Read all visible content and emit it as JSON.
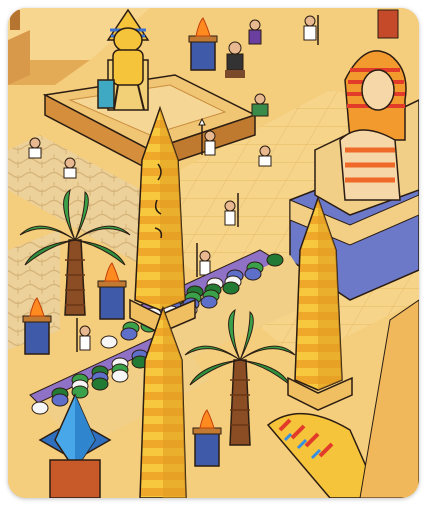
{
  "scene": {
    "title": "",
    "colors": {
      "sand_light": "#f8d98c",
      "sand_mid": "#efc06b",
      "sand_dark": "#d99c45",
      "plaza_tile": "#f3cf86",
      "cobble": "#e9c78e",
      "obelisk_gold": "#f4c23a",
      "obelisk_shade": "#e09a1f",
      "palm_green": "#3aa14a",
      "palm_dark": "#237a35",
      "trunk": "#8a4d24",
      "stone_blue": "#6c79c8",
      "stone_violet": "#8f72c6",
      "outline": "#2b1d12",
      "fire": "#ff8a1f",
      "crystal_blue": "#47a7e8"
    },
    "icons": [
      "pharaoh-statue-icon",
      "anubis-statue-icon",
      "obelisk-icon",
      "palm-tree-icon",
      "fire-brazier-icon",
      "spear-guard-icon",
      "worker-icon",
      "crystal-shrine-icon",
      "pharaoh-headdress-icon"
    ]
  }
}
